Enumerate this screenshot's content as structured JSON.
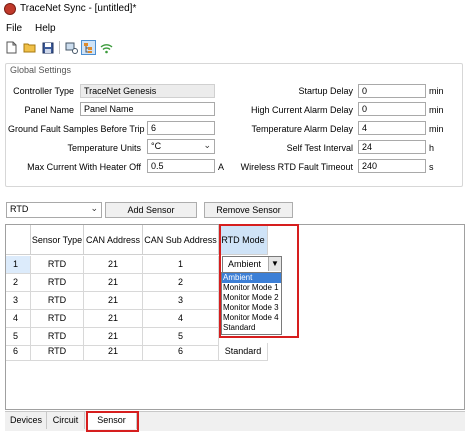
{
  "window": {
    "title": "TraceNet Sync - [untitled]*",
    "app_icon": "red-app-icon"
  },
  "menu": [
    "File",
    "Help"
  ],
  "toolbar": {
    "icons": [
      "new-file-icon",
      "open-folder-icon",
      "save-icon",
      "connect-icon",
      "tree-view-icon",
      "wireless-icon"
    ],
    "active_icon": "tree-view-icon"
  },
  "global_settings": {
    "title": "Global Settings",
    "controller_type": {
      "label": "Controller Type",
      "value": "TraceNet Genesis"
    },
    "panel_name": {
      "label": "Panel Name",
      "value": "Panel Name"
    },
    "ground_fault_samples": {
      "label": "Ground Fault Samples Before Trip",
      "value": "6"
    },
    "temperature_units": {
      "label": "Temperature Units",
      "value": "°C"
    },
    "max_current": {
      "label": "Max Current With Heater Off",
      "value": "0.5",
      "unit": "A"
    },
    "startup_delay": {
      "label": "Startup Delay",
      "value": "0",
      "unit": "min"
    },
    "high_current_alarm_delay": {
      "label": "High Current Alarm Delay",
      "value": "0",
      "unit": "min"
    },
    "temperature_alarm_delay": {
      "label": "Temperature Alarm Delay",
      "value": "4",
      "unit": "min"
    },
    "self_test_interval": {
      "label": "Self Test Interval",
      "value": "24",
      "unit": "h"
    },
    "wireless_rtd_fault_timeout": {
      "label": "Wireless RTD Fault Timeout",
      "value": "240",
      "unit": "s"
    }
  },
  "sensor_controls": {
    "sensor_type_value": "RTD",
    "add_label": "Add Sensor",
    "remove_label": "Remove Sensor"
  },
  "grid": {
    "columns": [
      "Sensor Type",
      "CAN Address",
      "CAN Sub Address",
      "RTD Mode"
    ],
    "rows": [
      {
        "num": "1",
        "type": "RTD",
        "can": "21",
        "sub": "1",
        "mode": "Ambient"
      },
      {
        "num": "2",
        "type": "RTD",
        "can": "21",
        "sub": "2",
        "mode": ""
      },
      {
        "num": "3",
        "type": "RTD",
        "can": "21",
        "sub": "3",
        "mode": ""
      },
      {
        "num": "4",
        "type": "RTD",
        "can": "21",
        "sub": "4",
        "mode": ""
      },
      {
        "num": "5",
        "type": "RTD",
        "can": "21",
        "sub": "5",
        "mode": ""
      },
      {
        "num": "6",
        "type": "RTD",
        "can": "21",
        "sub": "6",
        "mode": "Standard"
      }
    ]
  },
  "rtd_mode_dropdown": {
    "current": "Ambient",
    "options": [
      "Ambient",
      "Monitor Mode 1",
      "Monitor Mode 2",
      "Monitor Mode 3",
      "Monitor Mode 4",
      "Standard"
    ],
    "highlighted": "Ambient"
  },
  "tabs": [
    "Devices",
    "Circuit",
    "Sensor"
  ],
  "active_tab": "Sensor",
  "highlight_color": "#d61e1e",
  "selection_color": "#3c7fd6"
}
